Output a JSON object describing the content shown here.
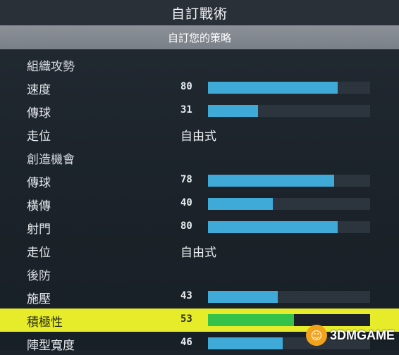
{
  "header": {
    "title": "自訂戰術",
    "subtitle": "自訂您的策略"
  },
  "rows": [
    {
      "kind": "section",
      "label": "組織攻勢"
    },
    {
      "kind": "slider",
      "label": "速度",
      "value": "80",
      "fill": 80
    },
    {
      "kind": "slider",
      "label": "傳球",
      "value": "31",
      "fill": 31
    },
    {
      "kind": "option",
      "label": "走位",
      "option": "自由式"
    },
    {
      "kind": "section",
      "label": "創造機會"
    },
    {
      "kind": "slider",
      "label": "傳球",
      "value": "78",
      "fill": 78
    },
    {
      "kind": "slider",
      "label": "橫傳",
      "value": "40",
      "fill": 40
    },
    {
      "kind": "slider",
      "label": "射門",
      "value": "80",
      "fill": 80
    },
    {
      "kind": "option",
      "label": "走位",
      "option": "自由式"
    },
    {
      "kind": "section",
      "label": "後防"
    },
    {
      "kind": "slider",
      "label": "施壓",
      "value": "43",
      "fill": 43
    },
    {
      "kind": "slider",
      "label": "積極性",
      "value": "53",
      "fill": 53,
      "selected": true
    },
    {
      "kind": "slider",
      "label": "陣型寬度",
      "value": "46",
      "fill": 46
    }
  ],
  "colors": {
    "bar_fill": "#3fa9d8",
    "selected_bar_fill": "#35c24a",
    "selected_row": "#e7ec2a"
  },
  "watermark": {
    "icon": "3dm-logo-icon",
    "text": "3DMGAME"
  }
}
